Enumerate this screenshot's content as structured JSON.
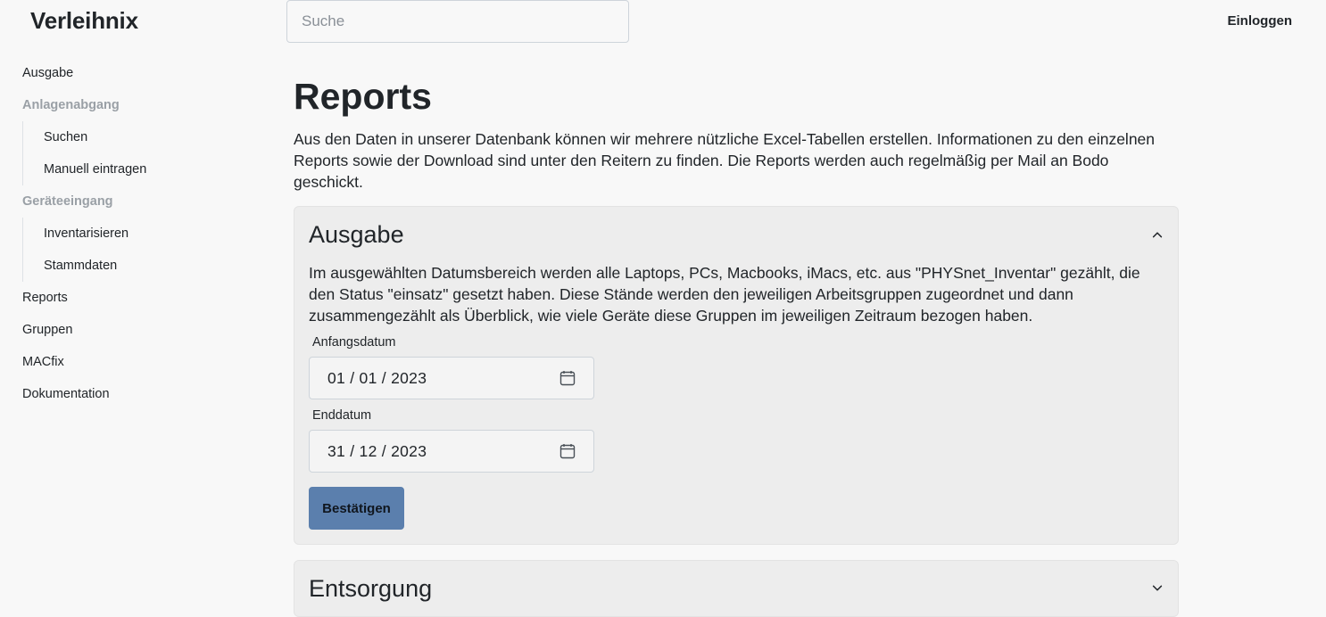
{
  "header": {
    "brand": "Verleihnix",
    "search_placeholder": "Suche",
    "login": "Einloggen"
  },
  "sidebar": {
    "items": [
      {
        "label": "Ausgabe"
      },
      {
        "label": "Anlagenabgang"
      },
      {
        "label": "Suchen"
      },
      {
        "label": "Manuell eintragen"
      },
      {
        "label": "Geräteeingang"
      },
      {
        "label": "Inventarisieren"
      },
      {
        "label": "Stammdaten"
      },
      {
        "label": "Reports"
      },
      {
        "label": "Gruppen"
      },
      {
        "label": "MACfix"
      },
      {
        "label": "Dokumentation"
      }
    ]
  },
  "main": {
    "title": "Reports",
    "intro": "Aus den Daten in unserer Datenbank können wir mehrere nützliche Excel-Tabellen erstellen. Informationen zu den einzelnen Reports sowie der Download sind unter den Reitern zu finden. Die Reports werden auch regelmäßig per Mail an Bodo geschickt.",
    "sections": [
      {
        "title": "Ausgabe",
        "expanded": true,
        "text": "Im ausgewählten Datumsbereich werden alle Laptops, PCs, Macbooks, iMacs, etc. aus \"PHYSnet_Inventar\" gezählt, die den Status \"einsatz\" gesetzt haben. Diese Stände werden den jeweiligen Arbeitsgruppen zugeordnet und dann zusammengezählt als Überblick, wie viele Geräte diese Gruppen im jeweiligen Zeitraum bezogen haben.",
        "start_label": "Anfangsdatum",
        "start_value": "01 / 01 / 2023",
        "end_label": "Enddatum",
        "end_value": "31 / 12 / 2023",
        "submit": "Bestätigen"
      },
      {
        "title": "Entsorgung",
        "expanded": false
      }
    ]
  },
  "colors": {
    "button_bg": "#5b7fad",
    "card_bg": "#ededed",
    "muted_heading": "#9aa0a6"
  }
}
